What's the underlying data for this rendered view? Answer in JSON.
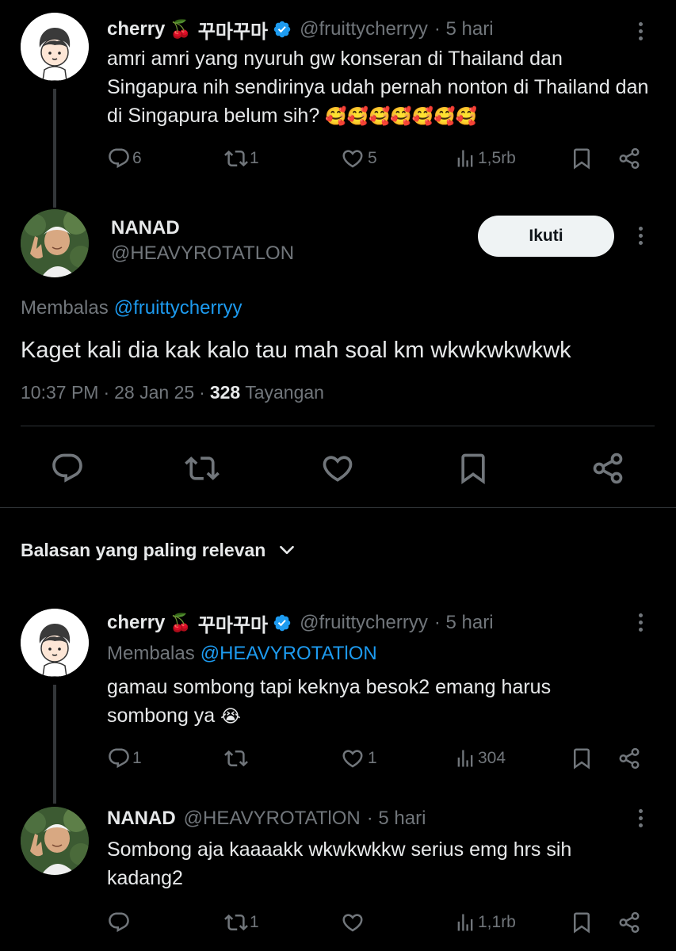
{
  "tweets": [
    {
      "display_name": "cherry",
      "name_emoji": "🍒",
      "korean": "꾸마꾸마",
      "handle": "@fruittycherryy",
      "time": "· 5 hari",
      "text": "amri amri yang nyuruh gw konseran di Thailand dan Singapura nih sendirinya udah pernah nonton di Thailand dan di Singapura belum sih?",
      "emojis": "🥰🥰🥰🥰🥰🥰🥰",
      "replies": "6",
      "retweets": "1",
      "likes": "5",
      "views": "1,5rb"
    }
  ],
  "main": {
    "display_name": "NANAD",
    "handle": "@HEAVYROTATLON",
    "follow_label": "Ikuti",
    "replying_label": "Membalas",
    "replying_to": "@fruittycherryy",
    "text": "Kaget kali dia kak kalo tau mah soal km wkwkwkwkwk",
    "time": "10:37 PM",
    "date": "28 Jan 25",
    "views": "328",
    "views_label": "Tayangan"
  },
  "sort": {
    "label": "Balasan yang paling relevan"
  },
  "replies": [
    {
      "display_name": "cherry",
      "name_emoji": "🍒",
      "korean": "꾸마꾸마",
      "handle": "@fruittycherryy",
      "time": "· 5 hari",
      "replying_label": "Membalas",
      "replying_to": "@HEAVYROTATlON",
      "text": "gamau sombong tapi keknya besok2 emang harus sombong ya",
      "emoji": "😭",
      "replies": "1",
      "retweets": "",
      "likes": "1",
      "views": "304"
    },
    {
      "display_name": "NANAD",
      "handle": "@HEAVYROTATlON",
      "time": "· 5 hari",
      "text": "Sombong aja kaaaakk wkwkwkkw serius emg hrs sih kadang2",
      "replies": "",
      "retweets": "1",
      "likes": "",
      "views": "1,1rb"
    }
  ],
  "icons": {
    "reply": "speech-bubble-icon",
    "retweet": "retweet-icon",
    "like": "heart-icon",
    "views": "bar-chart-icon",
    "bookmark": "bookmark-icon",
    "share": "share-icon",
    "more": "kebab-icon",
    "verified": "verified-badge-icon",
    "chevron": "chevron-down-icon"
  },
  "colors": {
    "background": "#000000",
    "text": "#e7e9ea",
    "muted": "#71767b",
    "link": "#1d9bf0",
    "divider": "#2f3336",
    "follow_button": "#eff3f4"
  }
}
